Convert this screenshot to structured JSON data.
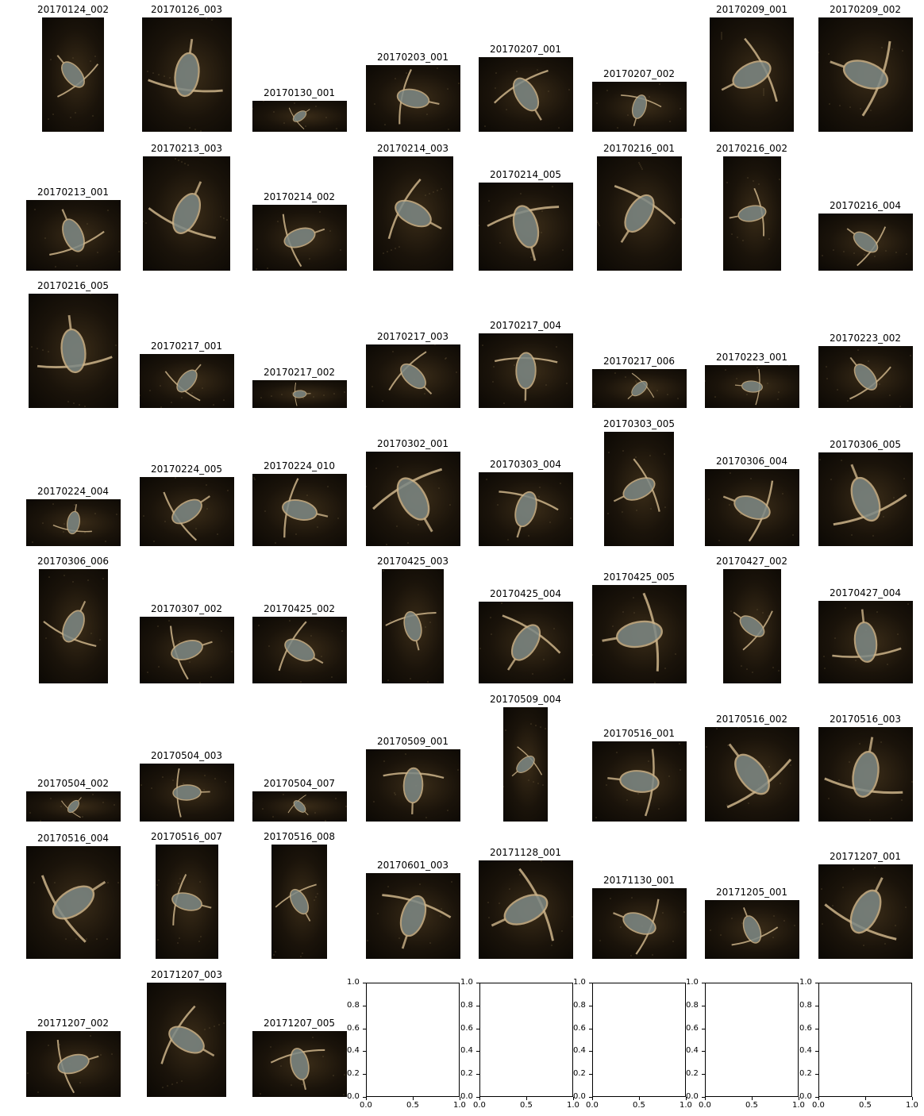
{
  "figure": {
    "rows": [
      [
        "20170124_002",
        "20170126_003",
        "20170130_001",
        "20170203_001",
        "20170207_001",
        "20170207_002",
        "20170209_001",
        "20170209_002"
      ],
      [
        "20170213_001",
        "20170213_003",
        "20170214_002",
        "20170214_003",
        "20170214_005",
        "20170216_001",
        "20170216_002",
        "20170216_004"
      ],
      [
        "20170216_005",
        "20170217_001",
        "20170217_002",
        "20170217_003",
        "20170217_004",
        "20170217_006",
        "20170223_001",
        "20170223_002"
      ],
      [
        "20170224_004",
        "20170224_005",
        "20170224_010",
        "20170302_001",
        "20170303_004",
        "20170303_005",
        "20170306_004",
        "20170306_005"
      ],
      [
        "20170306_006",
        "20170307_002",
        "20170425_002",
        "20170425_003",
        "20170425_004",
        "20170425_005",
        "20170427_002",
        "20170427_004"
      ],
      [
        "20170504_002",
        "20170504_003",
        "20170504_007",
        "20170509_001",
        "20170509_004",
        "20170516_001",
        "20170516_002",
        "20170516_003"
      ],
      [
        "20170516_004",
        "20170516_007",
        "20170516_008",
        "20170601_003",
        "20171128_001",
        "20171130_001",
        "20171205_001",
        "20171207_001"
      ],
      [
        "20171207_002",
        "20171207_003",
        "20171207_005"
      ]
    ],
    "empty_axes_count": 5,
    "empty_axes_ticks": {
      "y": [
        "1.0",
        "0.8",
        "0.6",
        "0.4",
        "0.2",
        "0.0"
      ],
      "x": [
        "0.0",
        "0.5",
        "1.0"
      ]
    },
    "colors": {
      "photo_background": "#1a130a",
      "specimen": "#cdb48a",
      "axes": "#000000"
    }
  }
}
